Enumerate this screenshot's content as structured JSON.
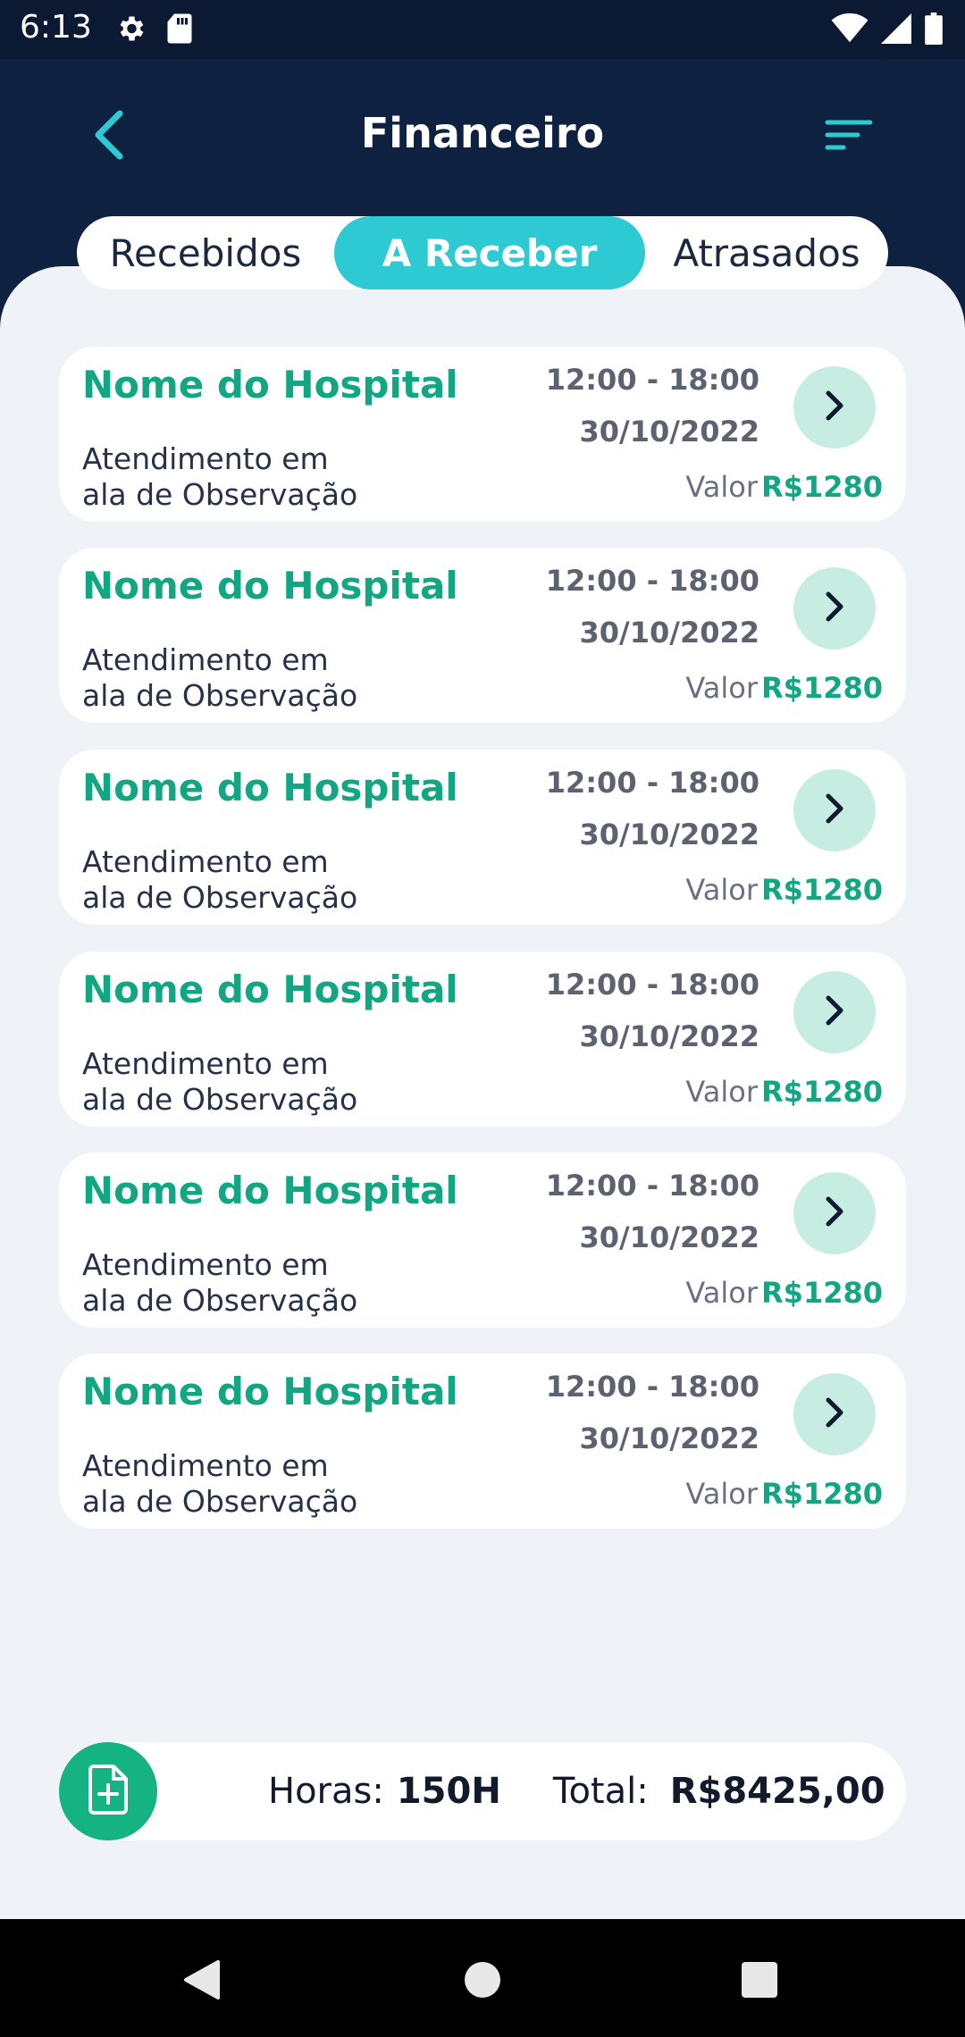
{
  "status_bar": {
    "time": "6:13"
  },
  "header": {
    "title": "Financeiro"
  },
  "tabs": [
    {
      "label": "Recebidos"
    },
    {
      "label": "A Receber"
    },
    {
      "label": "Atrasados"
    }
  ],
  "active_tab": "A Receber",
  "cards": [
    {
      "title": "Nome do Hospital",
      "description_line1": "Atendimento em",
      "description_line2": "ala de Observação",
      "time": "12:00 - 18:00",
      "date": "30/10/2022",
      "valor_label": "Valor",
      "valor": "R$1280"
    },
    {
      "title": "Nome do Hospital",
      "description_line1": "Atendimento em",
      "description_line2": "ala de Observação",
      "time": "12:00 - 18:00",
      "date": "30/10/2022",
      "valor_label": "Valor",
      "valor": "R$1280"
    },
    {
      "title": "Nome do Hospital",
      "description_line1": "Atendimento em",
      "description_line2": "ala de Observação",
      "time": "12:00 - 18:00",
      "date": "30/10/2022",
      "valor_label": "Valor",
      "valor": "R$1280"
    },
    {
      "title": "Nome do Hospital",
      "description_line1": "Atendimento em",
      "description_line2": "ala de Observação",
      "time": "12:00 - 18:00",
      "date": "30/10/2022",
      "valor_label": "Valor",
      "valor": "R$1280"
    },
    {
      "title": "Nome do Hospital",
      "description_line1": "Atendimento em",
      "description_line2": "ala de Observação",
      "time": "12:00 - 18:00",
      "date": "30/10/2022",
      "valor_label": "Valor",
      "valor": "R$1280"
    },
    {
      "title": "Nome do Hospital",
      "description_line1": "Atendimento em",
      "description_line2": "ala de Observação",
      "time": "12:00 - 18:00",
      "date": "30/10/2022",
      "valor_label": "Valor",
      "valor": "R$1280"
    }
  ],
  "summary": {
    "horas_label": "Horas:",
    "horas_value": "150H",
    "total_label": "Total:",
    "total_value": "R$8425,00"
  },
  "colors": {
    "header_bg": "#0f2140",
    "accent_teal": "#2ecad4",
    "green": "#12a682",
    "summary_icon_bg": "#14b381"
  },
  "icons": {
    "back": "chevron-left-icon",
    "filter": "sort-lines-icon",
    "card_arrow": "chevron-right-icon",
    "summary": "add-document-icon"
  }
}
